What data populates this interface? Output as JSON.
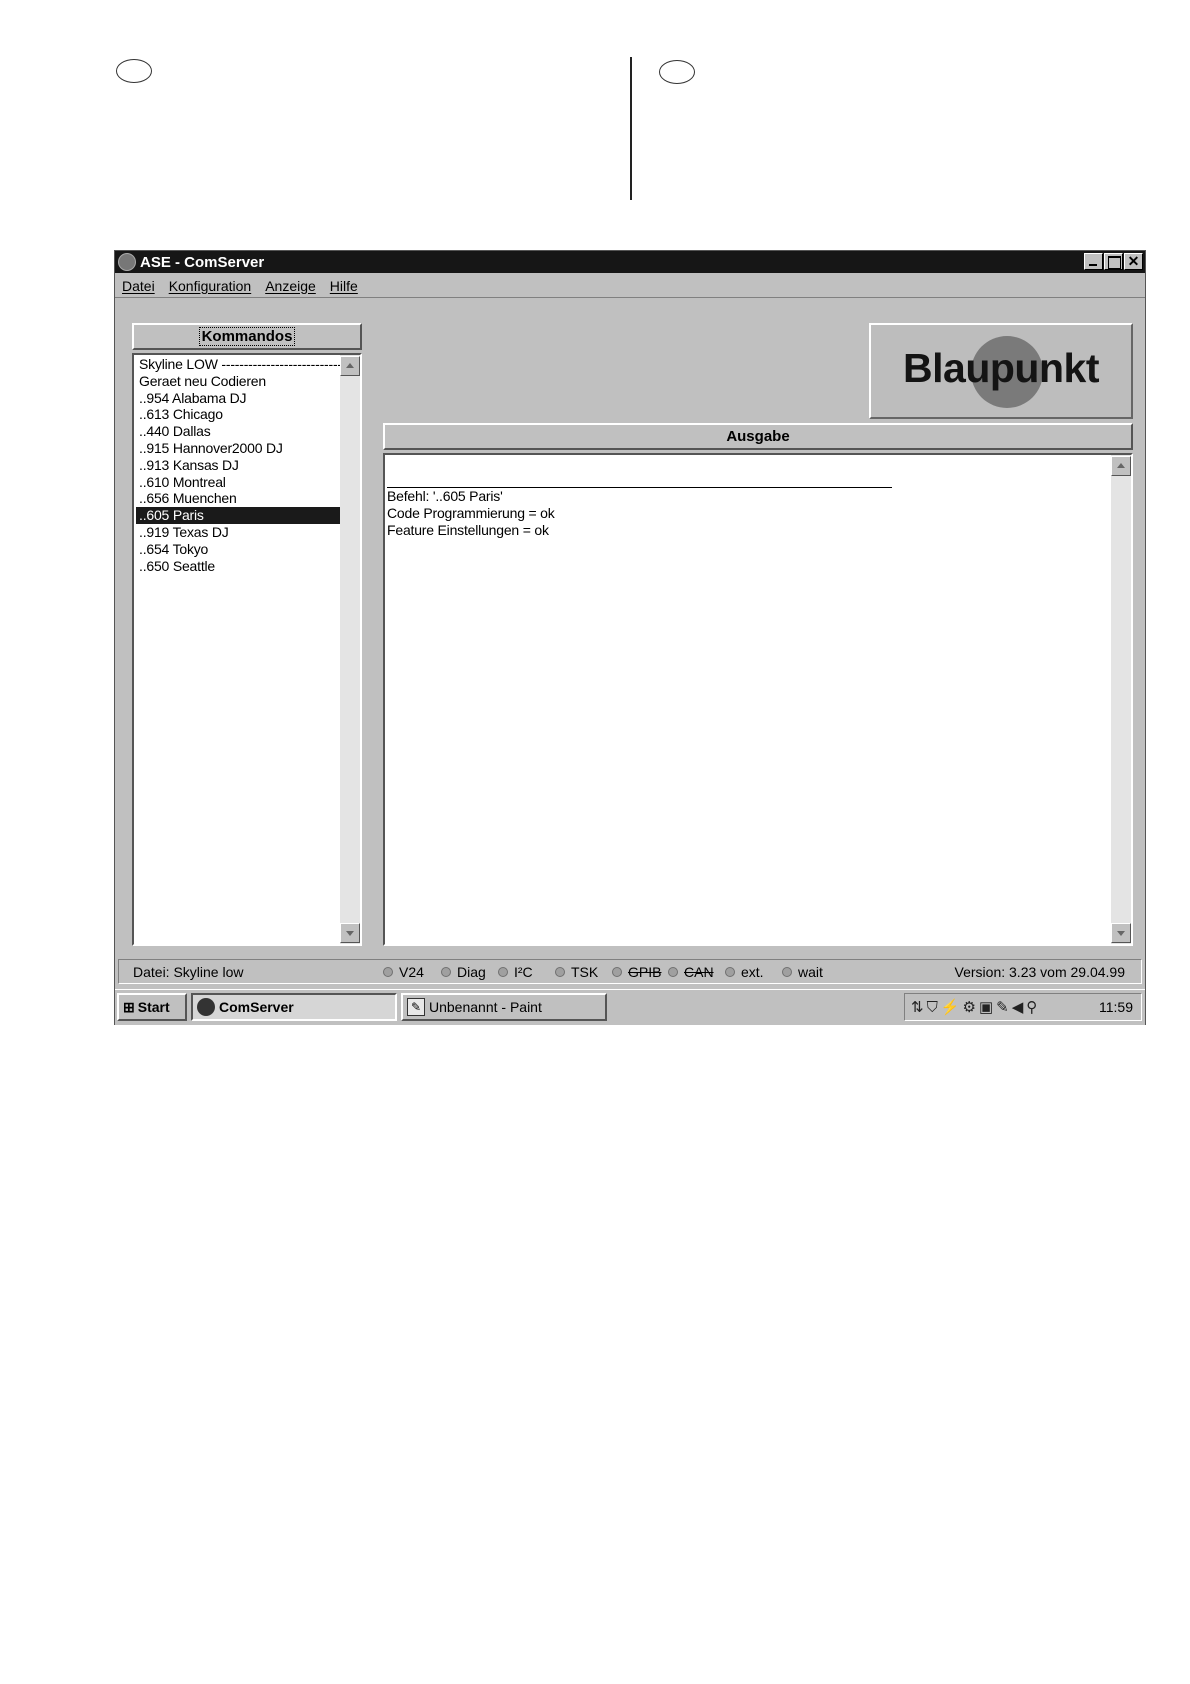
{
  "window": {
    "title": "ASE - ComServer",
    "controls": [
      "_",
      "□",
      "✕"
    ]
  },
  "menu": [
    "Datei",
    "Konfiguration",
    "Anzeige",
    "Hilfe"
  ],
  "commands": {
    "header": "Kommandos",
    "items": [
      "Skyline LOW --------------------------------",
      "Geraet neu Codieren",
      "..954 Alabama DJ",
      "..613 Chicago",
      "..440 Dallas",
      "..915 Hannover2000 DJ",
      "..913 Kansas DJ",
      "..610 Montreal",
      "..656 Muenchen",
      "..605 Paris",
      "..919 Texas DJ",
      "..654 Tokyo",
      "..650 Seattle"
    ],
    "selected": "..605 Paris"
  },
  "logo": {
    "text": "Blaupunkt"
  },
  "output": {
    "header": "Ausgabe",
    "lines": [
      "Befehl: '..605 Paris'",
      "Code Programmierung = ok",
      "Feature Einstellungen = ok"
    ]
  },
  "status": {
    "file": "Datei: Skyline low",
    "indicators": [
      "V24",
      "Diag",
      "I²C",
      "TSK",
      "GPIB",
      "CAN",
      "ext.",
      "wait"
    ],
    "version": "Version: 3.23 vom 29.04.99"
  },
  "taskbar": {
    "start": "Start",
    "tasks": [
      "ComServer",
      "Unbenannt - Paint"
    ],
    "clock": "11:59"
  }
}
